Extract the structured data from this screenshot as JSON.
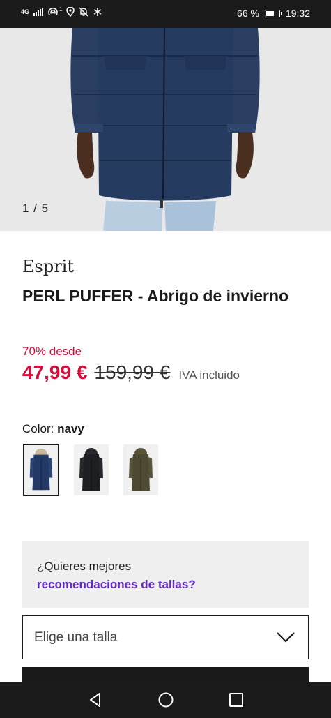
{
  "status_bar": {
    "network": "4G",
    "signal_superscript": "1",
    "battery_text": "66 %",
    "battery_level": 0.66,
    "time": "19:32",
    "icons": [
      "signal-icon",
      "hotspot-icon",
      "location-icon",
      "mute-icon",
      "bluetooth-icon",
      "battery-icon"
    ]
  },
  "gallery": {
    "counter": "1 / 5",
    "current": 1,
    "total": 5
  },
  "product": {
    "brand": "Esprit",
    "title": "PERL PUFFER - Abrigo de invierno",
    "discount_label": "70% desde",
    "price_now": "47,99 €",
    "price_old": "159,99 €",
    "vat_label": "IVA incluido"
  },
  "color": {
    "label": "Color: ",
    "selected": "navy",
    "options": [
      {
        "name": "navy",
        "hex": "#243a66"
      },
      {
        "name": "black",
        "hex": "#1e1f22"
      },
      {
        "name": "olive",
        "hex": "#4e4a32"
      }
    ]
  },
  "size_reco": {
    "question": "¿Quieres mejores",
    "link": "recomendaciones de tallas?"
  },
  "size_select": {
    "placeholder": "Elige una talla"
  },
  "colors": {
    "sale_red": "#d0103a",
    "link_purple": "#6328c8",
    "coat_navy": "#243a66"
  }
}
